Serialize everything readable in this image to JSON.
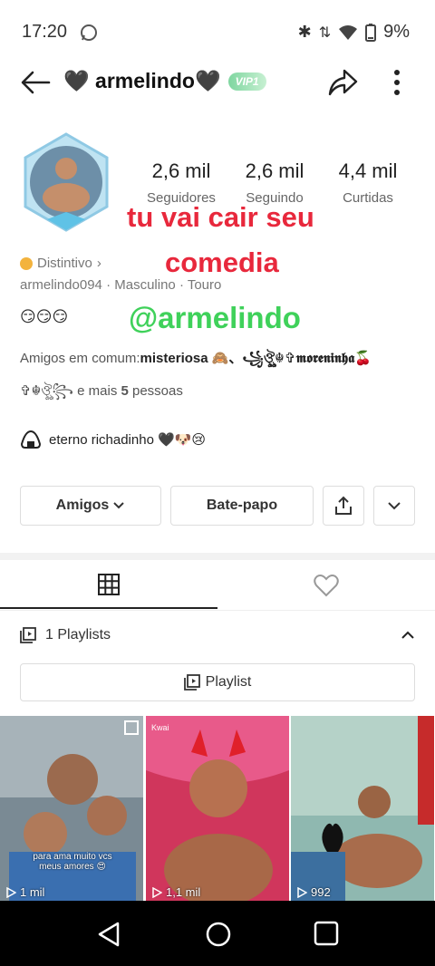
{
  "status": {
    "time": "17:20",
    "battery": "9%"
  },
  "header": {
    "username": "🖤 armelindo🖤",
    "vip": "VIP1"
  },
  "stats": [
    {
      "value": "2,6 mil",
      "label": "Seguidores"
    },
    {
      "value": "2,6 mil",
      "label": "Seguindo"
    },
    {
      "value": "4,4 mil",
      "label": "Curtidas"
    }
  ],
  "overlay": {
    "line1": "tu vai cair  seu",
    "line2": "comedia",
    "line3": "@armelindo"
  },
  "badge": {
    "label": "Distintivo",
    "chevron": "›"
  },
  "meta": {
    "id": "armelindo094",
    "gender": "Masculino",
    "sign": "Touro",
    "sep": " · "
  },
  "emojis": "😏😏😏",
  "friends": {
    "prefix": "Amigos em comum:",
    "names": "misteriosa 🙈、꧁ঔৣ☬✞𝖒𝖔𝖗𝖊𝖓𝖎𝖓𝖍𝖆🍒",
    "line2_names": "✞☬ঔৣ꧂",
    "line2_middle": " e mais ",
    "count": "5",
    "line2_suffix": " pessoas"
  },
  "bio": "eterno richadinho 🖤🐶😢",
  "buttons": {
    "friends": "Amigos",
    "chat": "Bate-papo"
  },
  "playlists": {
    "count_label": "1 Playlists",
    "button": "Playlist"
  },
  "videos": [
    {
      "views": "1 mil",
      "caption": "para ama muito vcs meus amores 😍"
    },
    {
      "views": "1,1 mil",
      "caption": "Kwai"
    },
    {
      "views": "992",
      "caption": ""
    }
  ],
  "colors": {
    "overlay_red": "#e8283c",
    "overlay_green": "#3fd15a",
    "vip": "#7fd6a0"
  }
}
